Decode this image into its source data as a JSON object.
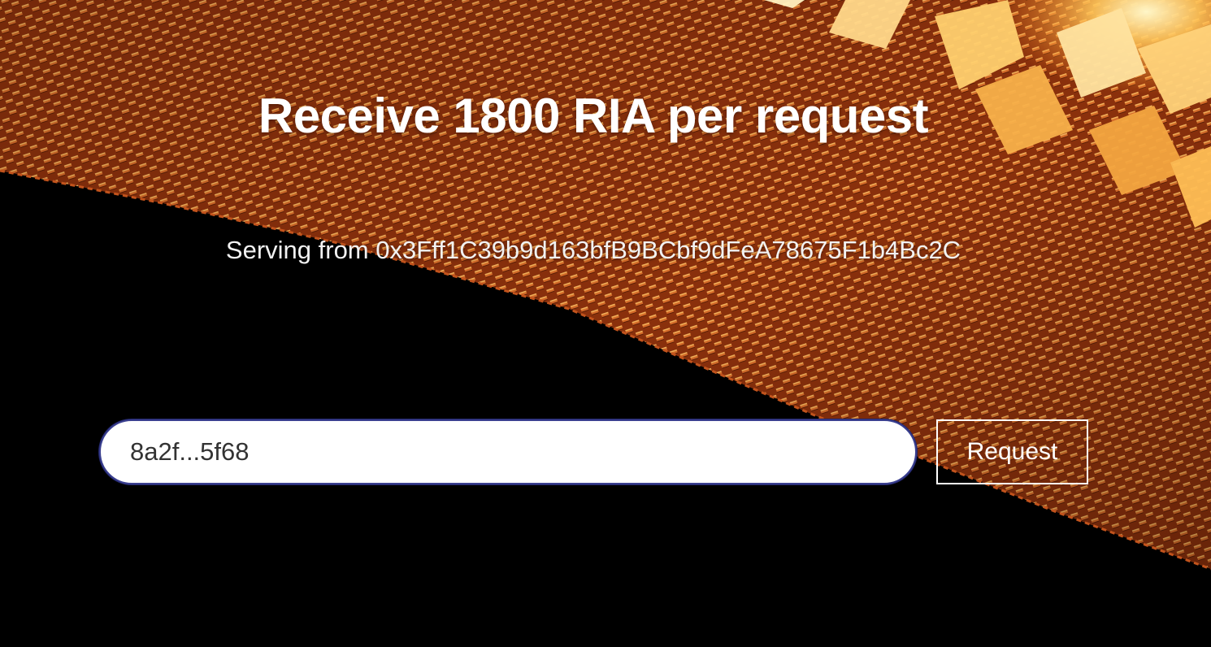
{
  "hero": {
    "title": "Receive 1800 RIA per request",
    "serving_text": "Serving from 0x3Fff1C39b9d163bfB9BCbf9dFeA78675F1b4Bc2C"
  },
  "form": {
    "address_value": "8a2f...5f68",
    "request_label": "Request"
  },
  "colors": {
    "background": "#000000",
    "mesh_dark": "#7a2a0a",
    "mesh_mid": "#c2531c",
    "mesh_light": "#f0a040",
    "glow": "#ffe9a0",
    "input_border": "#3a3f8f"
  }
}
